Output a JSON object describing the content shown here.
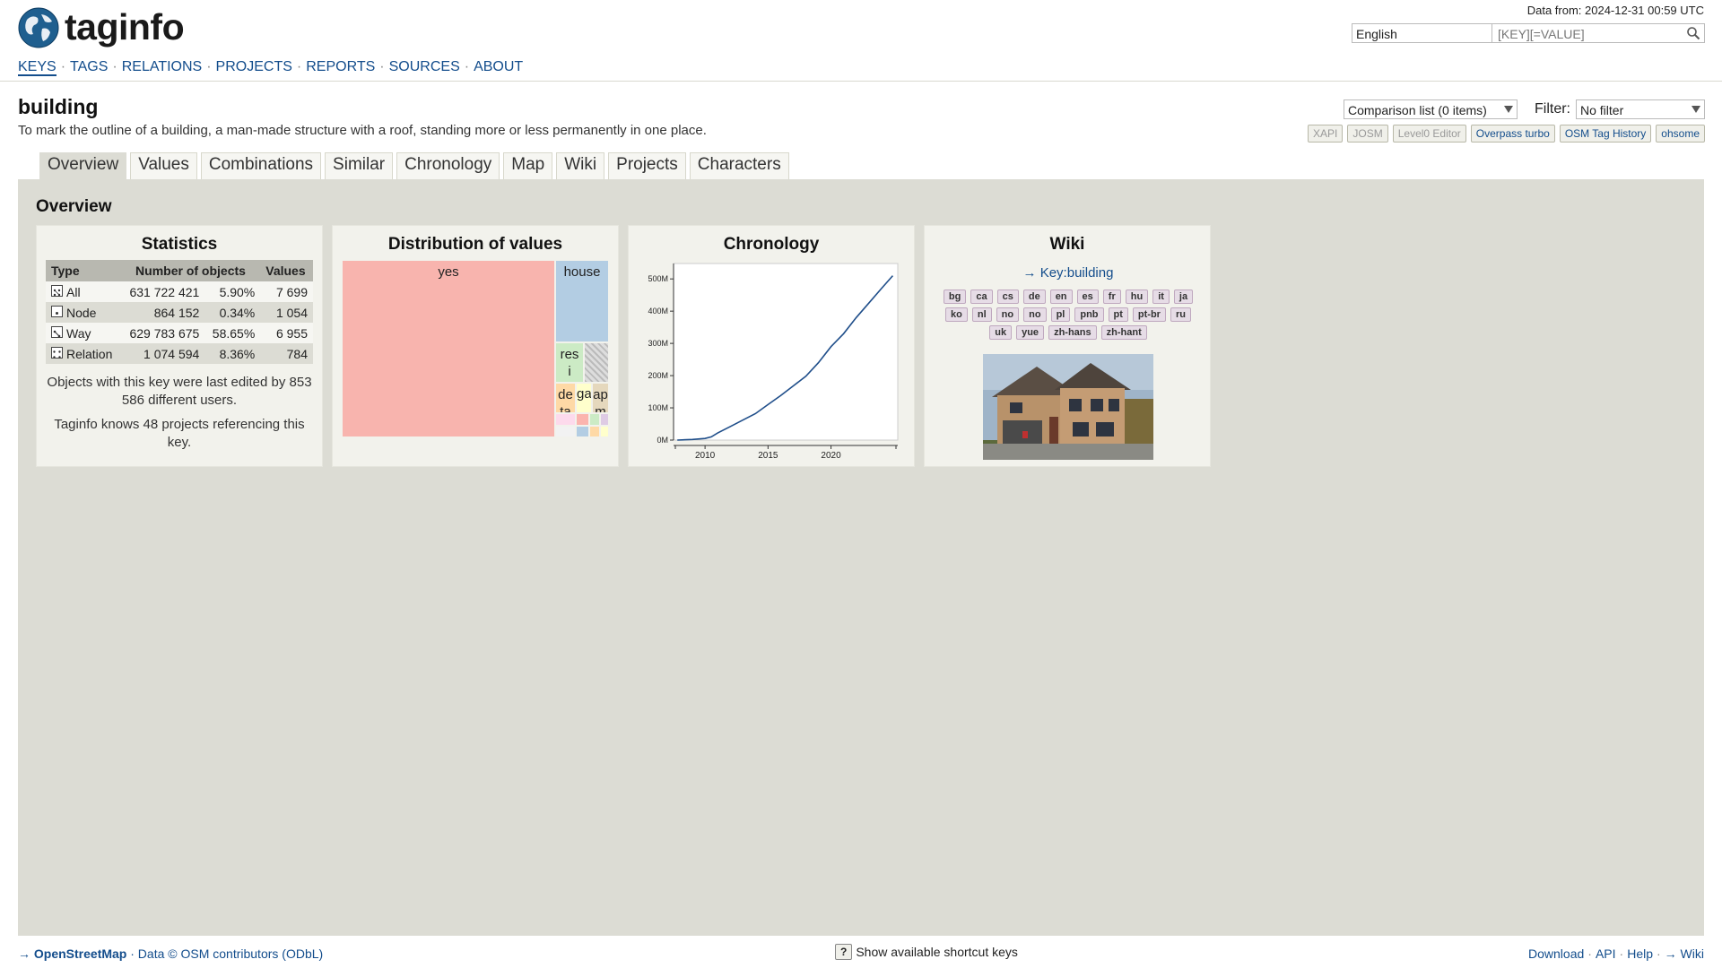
{
  "header": {
    "logo_text": "taginfo",
    "data_from": "Data from: 2024-12-31 00:59 UTC",
    "language": "English",
    "search_placeholder": "[KEY][=VALUE]",
    "nav": [
      "KEYS",
      "TAGS",
      "RELATIONS",
      "PROJECTS",
      "REPORTS",
      "SOURCES",
      "ABOUT"
    ],
    "nav_active": "KEYS"
  },
  "key": {
    "title": "building",
    "description": "To mark the outline of a building, a man-made structure with a roof, standing more or less permanently in one place."
  },
  "toolbar": {
    "comparison": "Comparison list (0 items)",
    "filter_label": "Filter:",
    "filter_value": "No filter",
    "ext_links": [
      {
        "label": "XAPI",
        "enabled": false
      },
      {
        "label": "JOSM",
        "enabled": false
      },
      {
        "label": "Level0 Editor",
        "enabled": false
      },
      {
        "label": "Overpass turbo",
        "enabled": true
      },
      {
        "label": "OSM Tag History",
        "enabled": true
      },
      {
        "label": "ohsome",
        "enabled": true
      }
    ]
  },
  "tabs": [
    "Overview",
    "Values",
    "Combinations",
    "Similar",
    "Chronology",
    "Map",
    "Wiki",
    "Projects",
    "Characters"
  ],
  "active_tab": "Overview",
  "overview": {
    "title": "Overview",
    "statistics": {
      "title": "Statistics",
      "headers": [
        "Type",
        "Number of objects",
        "Values"
      ],
      "rows": [
        {
          "type": "All",
          "count": "631 722 421",
          "percent": "5.90%",
          "values": "7 699"
        },
        {
          "type": "Node",
          "count": "864 152",
          "percent": "0.34%",
          "values": "1 054"
        },
        {
          "type": "Way",
          "count": "629 783 675",
          "percent": "58.65%",
          "values": "6 955"
        },
        {
          "type": "Relation",
          "count": "1 074 594",
          "percent": "8.36%",
          "values": "784"
        }
      ],
      "users_note": "Objects with this key were last edited by 853 586 different users.",
      "projects_note": "Taginfo knows 48 projects referencing this key."
    },
    "distribution": {
      "title": "Distribution of values",
      "labels": {
        "yes": "yes",
        "house": "house",
        "residential": "res\ni",
        "detached": "de\nta",
        "garage": "ga",
        "apartments": "ap\nm"
      }
    },
    "chronology": {
      "title": "Chronology"
    },
    "wiki": {
      "title": "Wiki",
      "link": "→ Key:building",
      "languages": [
        "bg",
        "ca",
        "cs",
        "de",
        "en",
        "es",
        "fr",
        "hu",
        "it",
        "ja",
        "ko",
        "nl",
        "no",
        "no",
        "pl",
        "pnb",
        "pt",
        "pt-br",
        "ru",
        "uk",
        "yue",
        "zh-hans",
        "zh-hant"
      ]
    }
  },
  "chart_data": {
    "type": "line",
    "title": "Chronology",
    "x": [
      2007.8,
      2009,
      2010,
      2010.5,
      2011,
      2012,
      2013,
      2014,
      2015,
      2016,
      2017,
      2018,
      2019,
      2020,
      2021,
      2022,
      2023,
      2024,
      2024.9
    ],
    "values": [
      0,
      2,
      5,
      10,
      22,
      42,
      62,
      82,
      110,
      138,
      168,
      198,
      240,
      290,
      330,
      380,
      425,
      470,
      510
    ],
    "x_ticks": [
      "2010",
      "2015",
      "2020"
    ],
    "y_ticks": [
      "0M",
      "100M",
      "200M",
      "300M",
      "400M",
      "500M"
    ],
    "ylim": [
      0,
      520
    ],
    "xlim": [
      2007.5,
      2025.3
    ]
  },
  "footer": {
    "osm_link": "OpenStreetMap",
    "data_credit": "· Data © OSM contributors (ODbL)",
    "kbd": "?",
    "shortcut_text": "Show available shortcut keys",
    "right_links": [
      "Download",
      "API",
      "Help",
      "→ Wiki"
    ]
  }
}
